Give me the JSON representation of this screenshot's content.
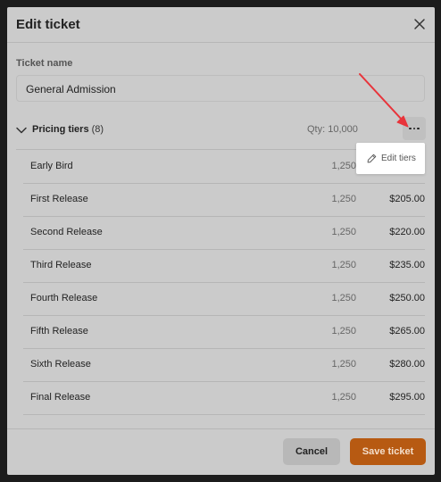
{
  "modal": {
    "title": "Edit ticket",
    "ticket_name_label": "Ticket name",
    "ticket_name_value": "General Admission"
  },
  "tiers": {
    "label": "Pricing tiers",
    "count": "(8)",
    "qty": "Qty: 10,000",
    "rows": [
      {
        "name": "Early Bird",
        "qty": "1,250",
        "price": ""
      },
      {
        "name": "First Release",
        "qty": "1,250",
        "price": "$205.00"
      },
      {
        "name": "Second Release",
        "qty": "1,250",
        "price": "$220.00"
      },
      {
        "name": "Third Release",
        "qty": "1,250",
        "price": "$235.00"
      },
      {
        "name": "Fourth Release",
        "qty": "1,250",
        "price": "$250.00"
      },
      {
        "name": "Fifth Release",
        "qty": "1,250",
        "price": "$265.00"
      },
      {
        "name": "Sixth Release",
        "qty": "1,250",
        "price": "$280.00"
      },
      {
        "name": "Final Release",
        "qty": "1,250",
        "price": "$295.00"
      }
    ]
  },
  "menu": {
    "edit_tiers_label": "Edit tiers"
  },
  "footer": {
    "cancel_label": "Cancel",
    "save_label": "Save ticket"
  },
  "icons": {
    "close": "close-icon",
    "chevron": "chevron-down-icon",
    "more": "more-horizontal-icon",
    "pencil": "pencil-icon"
  },
  "colors": {
    "accent": "#b75a12",
    "annotation_arrow": "#e8343b"
  }
}
